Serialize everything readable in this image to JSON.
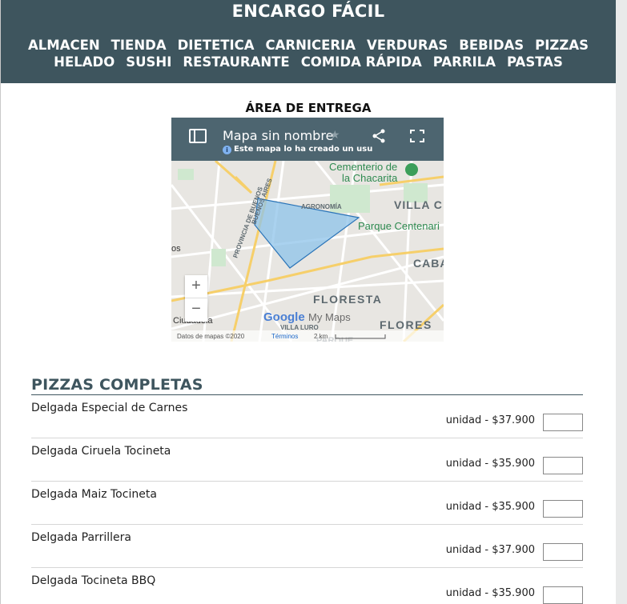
{
  "header": {
    "title": "ENCARGO FÁCIL",
    "nav_row1": [
      "ALMACEN",
      "TIENDA",
      "DIETETICA",
      "CARNICERIA",
      "VERDURAS",
      "BEBIDAS",
      "PIZZAS"
    ],
    "nav_row2": [
      "HELADO",
      "SUSHI",
      "RESTAURANTE",
      "COMIDA RÁPIDA",
      "PARRILA",
      "PASTAS"
    ]
  },
  "delivery": {
    "title": "ÁREA DE ENTREGA",
    "map": {
      "title": "Mapa sin nombre",
      "subtitle": "Este mapa lo ha creado un usu",
      "labels": [
        "Cementerio de",
        "la Chacarita",
        "VILLA C",
        "AGRONOMÍA",
        "Parque Centenari",
        "CABA",
        "FLORESTA",
        "FLORES",
        "PROVINCIA DE BUENOS",
        "BUENOS AIRES",
        "VILLA LURO",
        "Ciudadela",
        "os",
        "PARQUE"
      ],
      "footer": {
        "attribution": "Datos de mapas ©2020",
        "terms": "Términos",
        "scale": "2 km"
      },
      "brand": {
        "google": "Google",
        "mymaps": "My Maps"
      },
      "zoom_in": "+",
      "zoom_out": "−",
      "colors": {
        "header": "#4d6570",
        "polygon_fill": "#8ec3ea",
        "polygon_stroke": "#2a74b8"
      }
    }
  },
  "section": {
    "title": "PIZZAS COMPLETAS",
    "items": [
      {
        "name": "Delgada Especial de Carnes",
        "price": "unidad - $37.900",
        "qty": ""
      },
      {
        "name": "Delgada Ciruela Tocineta",
        "price": "unidad - $35.900",
        "qty": ""
      },
      {
        "name": "Delgada Maiz Tocineta",
        "price": "unidad - $35.900",
        "qty": ""
      },
      {
        "name": "Delgada Parrillera",
        "price": "unidad - $37.900",
        "qty": ""
      },
      {
        "name": "Delgada Tocineta BBQ",
        "price": "unidad - $35.900",
        "qty": ""
      }
    ]
  },
  "colors": {
    "topbar": "#3e555e",
    "accent": "#3e555e"
  }
}
